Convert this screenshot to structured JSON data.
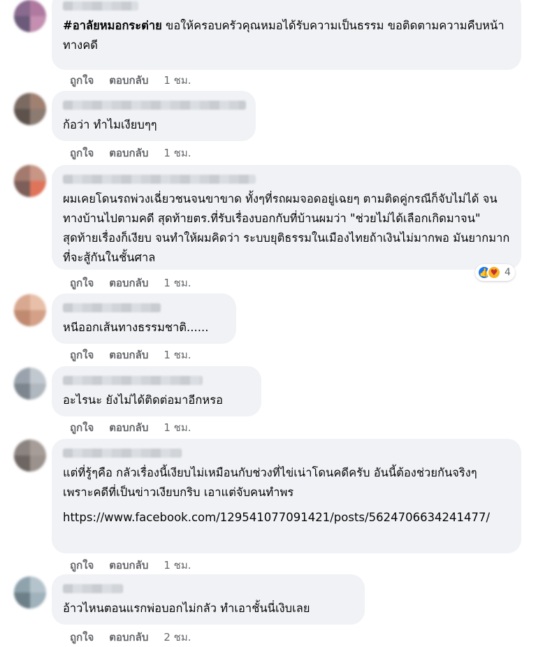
{
  "comments": [
    {
      "hashtag": "#อาลัยหมอกระต่าย",
      "text": " ขอให้ครอบครัวคุณหมอได้รับความเป็นธรรม ขอติดตามความคืบหน้าทางคดี",
      "like": "ถูกใจ",
      "reply": "ตอบกลับ",
      "time": "1 ชม.",
      "avatar_colors": [
        "#8a6a8f",
        "#b07aa0",
        "#6b5a7a",
        "#c48fb0"
      ]
    },
    {
      "text": "ก้อว่า ทำไมเงียบๆๆ",
      "like": "ถูกใจ",
      "reply": "ตอบกลับ",
      "time": "1 ชม.",
      "avatar_colors": [
        "#7a6a62",
        "#a08070",
        "#5d524c",
        "#8c7b70"
      ]
    },
    {
      "text": "ผมเคยโดนรถพ่วงเฉี่ยวชนจนขาขาด ทั้งๆที่รถผมจอดอยู่เฉยๆ ตามติดคู่กรณีก็จับไม่ได้ จนทางบ้านไปตามคดี สุดท้ายตร.ที่รับเรื่องบอกกับที่บ้านผมว่า \"ช่วยไม่ได้เลือกเกิดมาจน\" สุดท้ายเรื่องก็เงียบ จนทำให้ผมคิดว่า ระบบยุติธรรมในเมืองไทยถ้าเงินไม่มากพอ มันยากมากที่จะสู้กันในชั้นศาล",
      "like": "ถูกใจ",
      "reply": "ตอบกลับ",
      "time": "1 ชม.",
      "reaction_count": "4",
      "avatar_colors": [
        "#a37a6e",
        "#c99585",
        "#7d5e58",
        "#e0745a"
      ]
    },
    {
      "text": "หนีออกเส้นทางธรรมชาติ......",
      "like": "ถูกใจ",
      "reply": "ตอบกลับ",
      "time": "1 ชม.",
      "avatar_colors": [
        "#d9a890",
        "#e8bfa8",
        "#c08a70",
        "#d4a088"
      ]
    },
    {
      "text": "อะไรนะ ยังไม่ได้ติดต่อมาอีกหรอ",
      "like": "ถูกใจ",
      "reply": "ตอบกลับ",
      "time": "1 ชม.",
      "avatar_colors": [
        "#9aa3ad",
        "#c2c8cf",
        "#7d858e",
        "#b0b7bf"
      ]
    },
    {
      "text": "แต่ที่รู้ๆคือ กลัวเรื่องนี้เงียบไม่เหมือนกับช่วงที่ไข่เน่าโดนคดีครับ อันนี้ต้องช่วยกันจริงๆ เพราะคดีที่เป็นข่าวเงียบกริบ เอาแต่จับคนทำพร",
      "link": "https://www.facebook.com/129541077091421/posts/5624706634241477/",
      "like": "ถูกใจ",
      "reply": "ตอบกลับ",
      "time": "1 ชม.",
      "avatar_colors": [
        "#8c8480",
        "#a79d98",
        "#6e6662",
        "#9c928d"
      ]
    },
    {
      "text": "อ้าวไหนตอนแรกพ่อบอกไม่กลัว ทำเอาชั้นนี่เงิบเลย",
      "like": "ถูกใจ",
      "reply": "ตอบกลับ",
      "time": "2 ชม.",
      "avatar_colors": [
        "#8fa3ad",
        "#b5c4cc",
        "#6d7f88",
        "#a0b2bb"
      ]
    }
  ]
}
